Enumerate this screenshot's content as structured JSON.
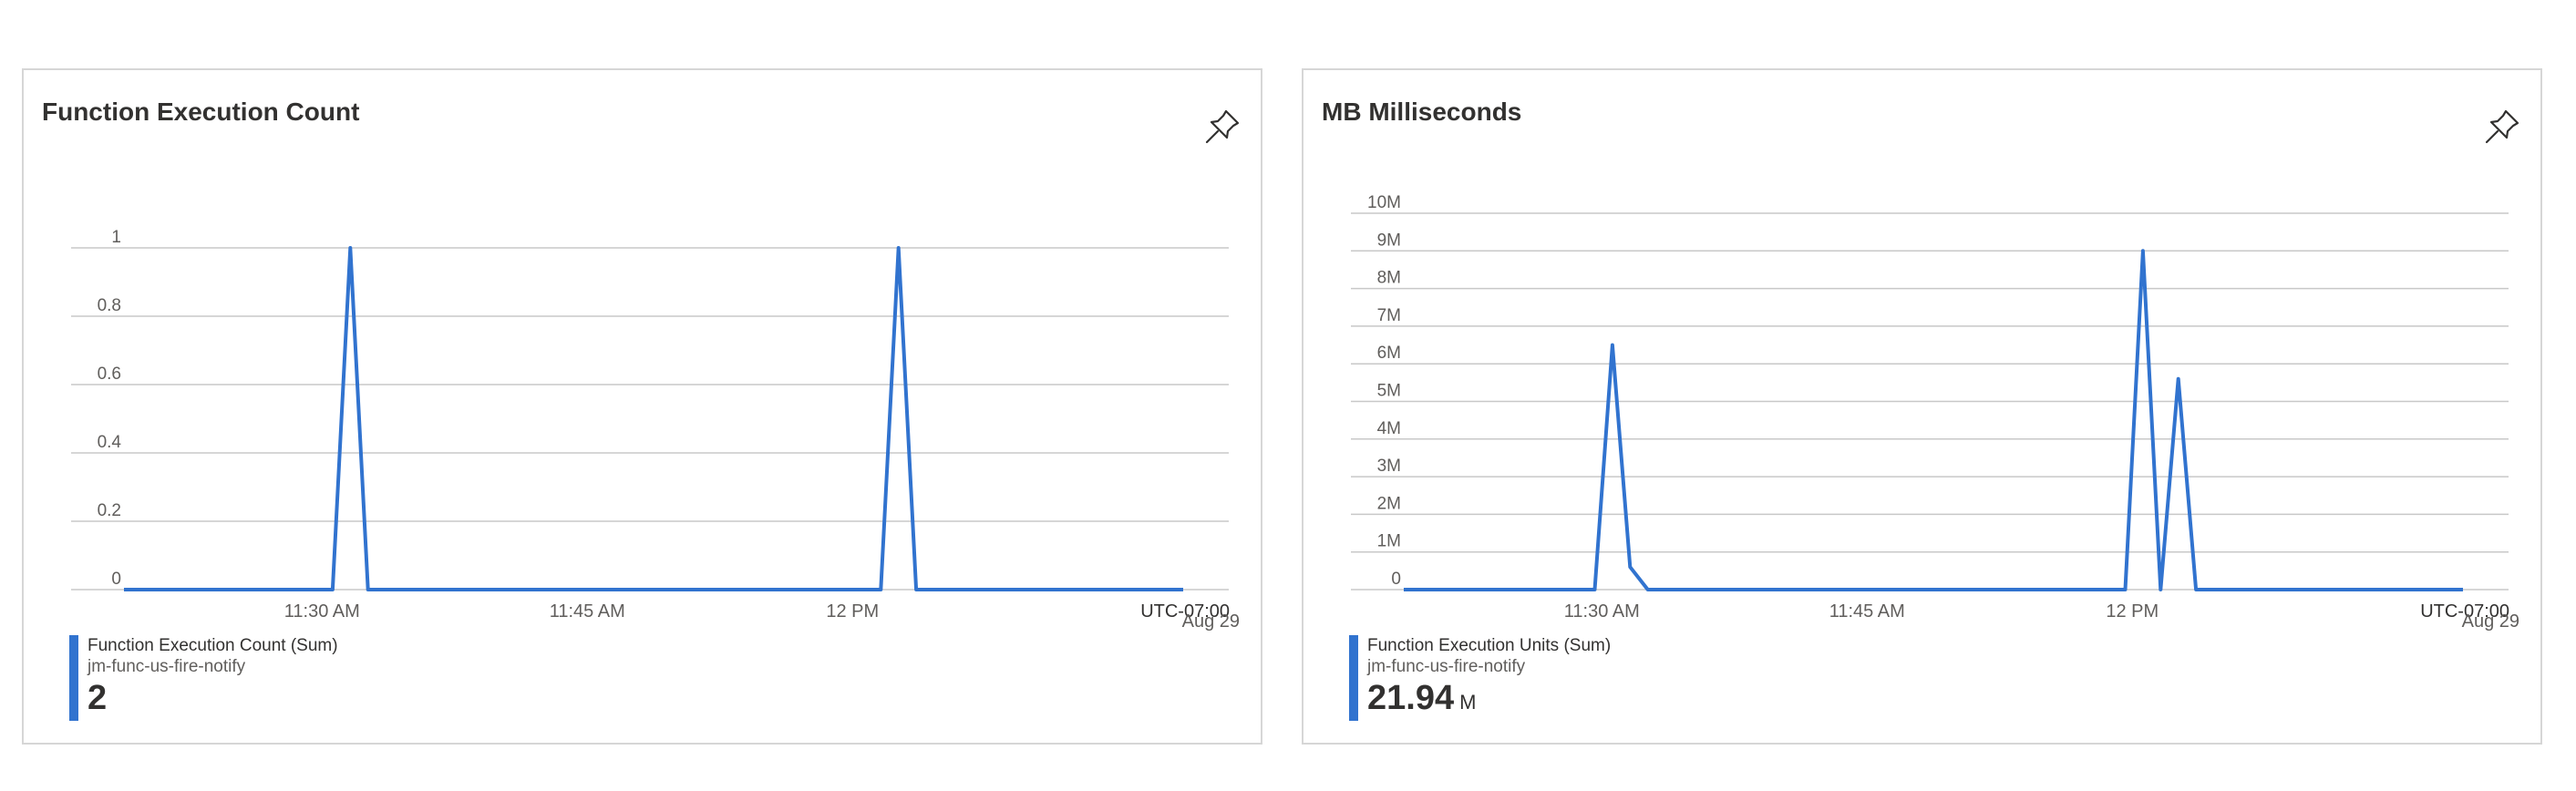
{
  "colors": {
    "series": "#3173cf",
    "grid": "#c8c8c8",
    "axis_text": "#605e5c",
    "border": "#d6d6d6"
  },
  "cards": [
    {
      "title": "Function Execution Count",
      "pin_icon": "pin-icon",
      "legend": {
        "metric": "Function Execution Count (Sum)",
        "resource": "jm-func-us-fire-notify",
        "value": "2",
        "unit": ""
      }
    },
    {
      "title": "MB Milliseconds",
      "pin_icon": "pin-icon",
      "legend": {
        "metric": "Function Execution Units (Sum)",
        "resource": "jm-func-us-fire-notify",
        "value": "21.94",
        "unit": "M"
      }
    }
  ],
  "chart_data": [
    {
      "type": "line",
      "title": "Function Execution Count",
      "x_ticks": [
        "11:30 AM",
        "11:45 AM",
        "12 PM"
      ],
      "x_tick_minutes": [
        30,
        45,
        60
      ],
      "timezone_label": "UTC-07:00",
      "date_label": "Aug 29",
      "y_ticks": [
        "0",
        "0.2",
        "0.4",
        "0.6",
        "0.8",
        "1"
      ],
      "ylim": [
        0,
        1
      ],
      "xlim_minutes": [
        18.8,
        78.7
      ],
      "grid": true,
      "series": [
        {
          "name": "Function Execution Count (Sum)",
          "x_minutes": [
            18.8,
            30.6,
            31.6,
            32.6,
            61.6,
            62.6,
            63.6,
            78.7
          ],
          "values": [
            0,
            0,
            1,
            0,
            0,
            1,
            0,
            0
          ]
        }
      ]
    },
    {
      "type": "line",
      "title": "MB Milliseconds",
      "x_ticks": [
        "11:30 AM",
        "11:45 AM",
        "12 PM"
      ],
      "x_tick_minutes": [
        30,
        45,
        60
      ],
      "timezone_label": "UTC-07:00",
      "date_label": "Aug 29",
      "y_ticks": [
        "0",
        "1M",
        "2M",
        "3M",
        "4M",
        "5M",
        "6M",
        "7M",
        "8M",
        "9M",
        "10M"
      ],
      "ylim": [
        0,
        10000000
      ],
      "xlim_minutes": [
        18.8,
        78.7
      ],
      "grid": true,
      "series": [
        {
          "name": "Function Execution Units (Sum)",
          "x_minutes": [
            18.8,
            29.6,
            30.6,
            31.6,
            32.6,
            59.6,
            60.6,
            61.6,
            62.6,
            63.6,
            78.7
          ],
          "values": [
            0,
            0,
            6500000,
            600000,
            0,
            0,
            9000000,
            0,
            5600000,
            0,
            0
          ]
        }
      ]
    }
  ]
}
